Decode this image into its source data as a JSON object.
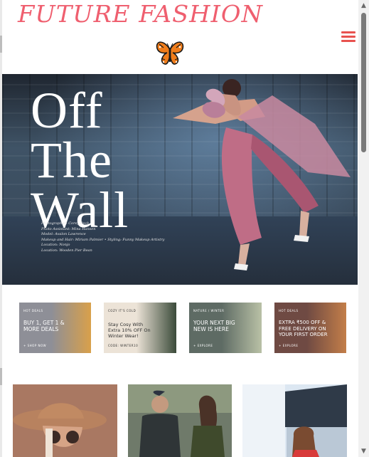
{
  "brand": {
    "title": "FUTURE FASHION"
  },
  "hero": {
    "title_lines": [
      "Off",
      "The",
      "Wall"
    ],
    "credits": [
      "Photographer: Corey Beck",
      "Photo Assistant: Mina Hansen",
      "Model: Avalon Lawrence",
      "Makeup and Hair: Miriam Palmier • Styling: Funny Makeup Artistry",
      "Location: Nonjo",
      "Location: Wooden Pier Bean"
    ]
  },
  "promos": [
    {
      "tag": "HOT DEALS",
      "headline": "BUY 1, GET 1 & MORE DEALS",
      "cta": "+ SHOP NOW",
      "bg": "#8e8f97",
      "accent": "#d9a04a"
    },
    {
      "tag": "COZY IT'S COLD",
      "headline": "Stay Cosy With Extra 10% OFF On Winter Wear!",
      "cta": "CODE: WINTER10",
      "bg": "#ece3d7",
      "accent": "#3b4b3a"
    },
    {
      "tag": "NATURE / WINTER",
      "headline": "YOUR NEXT BIG NEW IS HERE",
      "cta": "+ EXPLORE",
      "bg": "#5e6b64",
      "accent": "#b9c1a6"
    },
    {
      "tag": "HOT DEALS",
      "headline": "EXTRA ₹500 OFF & FREE DELIVERY ON YOUR FIRST ORDER",
      "cta": "+ EXPLORE",
      "bg": "#6f4a43",
      "accent": "#c37e49"
    }
  ],
  "cards": [
    {
      "name": "card-model-hat",
      "bg": "#9b6b58"
    },
    {
      "name": "card-couple-jackets",
      "bg": "#4f5a48"
    },
    {
      "name": "card-woman-storefront",
      "bg": "#d7e3ef"
    }
  ],
  "colors": {
    "brand": "#ef5f6f",
    "menu": "#e8524f"
  }
}
